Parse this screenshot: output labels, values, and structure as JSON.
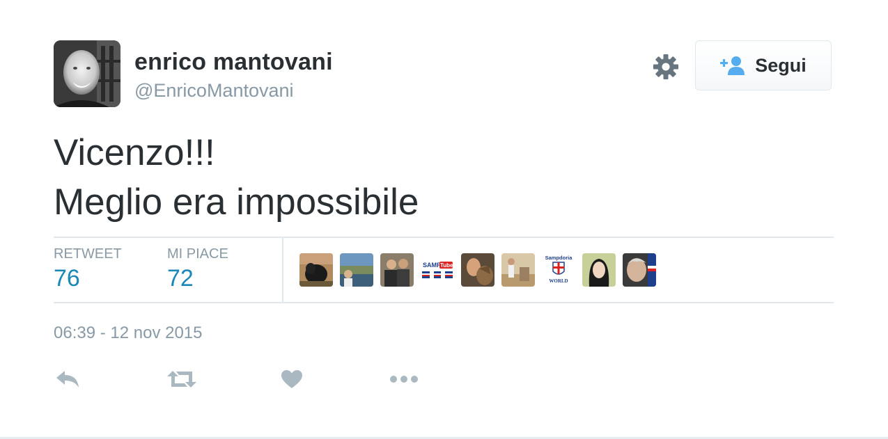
{
  "user": {
    "display_name": "enrico mantovani",
    "username": "@EnricoMantovani",
    "avatar_icon": "profile-photo"
  },
  "header": {
    "settings_icon": "gear-icon",
    "follow_button": {
      "label": "Segui",
      "icon": "add-user-icon",
      "icon_color": "#55acee"
    }
  },
  "tweet": {
    "lines": [
      "Vicenzo!!!",
      "Meglio era impossibile"
    ]
  },
  "stats": {
    "retweets": {
      "label": "RETWEET",
      "value": "76"
    },
    "likes": {
      "label": "MI PIACE",
      "value": "72"
    },
    "accent_color": "#1b88b6"
  },
  "liked_by": [
    {
      "name": "liker-avatar-1"
    },
    {
      "name": "liker-avatar-2"
    },
    {
      "name": "liker-avatar-3"
    },
    {
      "name": "liker-avatar-4",
      "text_a": "SAMP",
      "text_b": "Tube"
    },
    {
      "name": "liker-avatar-5"
    },
    {
      "name": "liker-avatar-6"
    },
    {
      "name": "liker-avatar-7",
      "text_a": "Sampdoria",
      "text_b": "WORLD"
    },
    {
      "name": "liker-avatar-8"
    },
    {
      "name": "liker-avatar-9"
    }
  ],
  "timestamp": "06:39 - 12 nov 2015",
  "actions": [
    {
      "name": "reply",
      "icon": "reply-icon"
    },
    {
      "name": "retweet",
      "icon": "retweet-icon"
    },
    {
      "name": "like",
      "icon": "heart-icon"
    },
    {
      "name": "more",
      "icon": "more-icon"
    }
  ],
  "colors": {
    "muted": "#8899a6",
    "text": "#292f33",
    "icon": "#aab8c2"
  }
}
